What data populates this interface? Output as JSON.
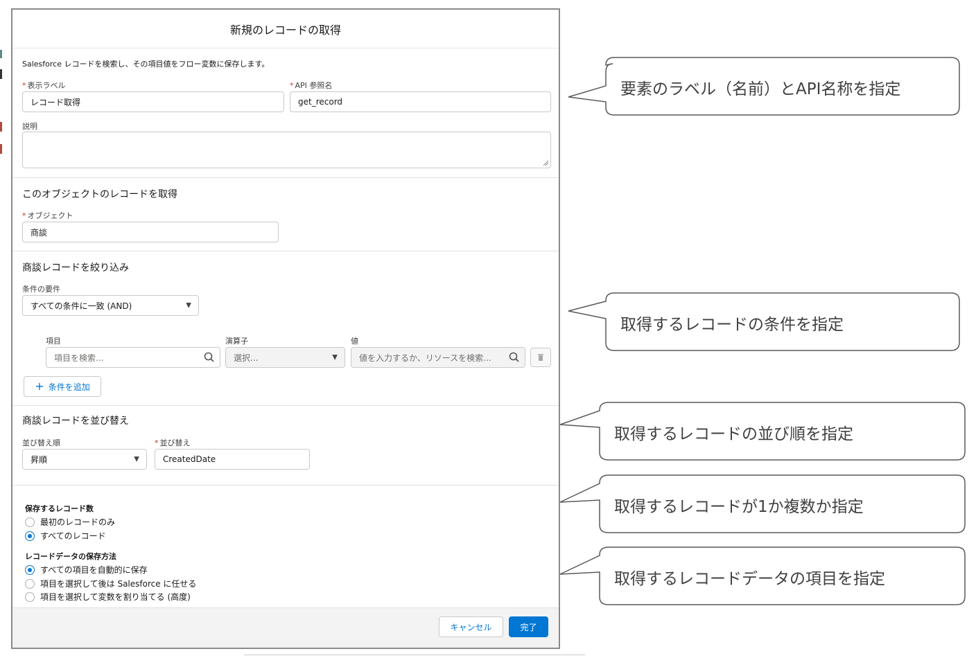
{
  "modal": {
    "title": "新規のレコードの取得",
    "description": "Salesforce レコードを検索し、その項目値をフロー変数に保存します。",
    "required_mark": "*",
    "label_field": {
      "label": "表示ラベル",
      "value": "レコード取得"
    },
    "api_field": {
      "label": "API 参照名",
      "value": "get_record"
    },
    "desc_field": {
      "label": "説明",
      "value": ""
    },
    "object_section": {
      "title": "このオブジェクトのレコードを取得",
      "object_label": "オブジェクト",
      "object_value": "商談"
    },
    "filter_section": {
      "title": "商談レコードを絞り込み",
      "condition_label": "条件の要件",
      "condition_value": "すべての条件に一致 (AND)",
      "col_field": "項目",
      "col_operator": "演算子",
      "col_value": "値",
      "field_placeholder": "項目を検索...",
      "operator_placeholder": "選択...",
      "value_placeholder": "値を入力するか、リソースを検索...",
      "add_condition": "条件を追加"
    },
    "sort_section": {
      "title": "商談レコードを並び替え",
      "order_label": "並び替え順",
      "order_value": "昇順",
      "sortby_label": "並び替え",
      "sortby_value": "CreatedDate"
    },
    "count_section": {
      "label": "保存するレコード数",
      "options": [
        {
          "label": "最初のレコードのみ",
          "selected": false
        },
        {
          "label": "すべてのレコード",
          "selected": true
        }
      ]
    },
    "store_section": {
      "label": "レコードデータの保存方法",
      "options": [
        {
          "label": "すべての項目を自動的に保存",
          "selected": true
        },
        {
          "label": "項目を選択して後は Salesforce に任せる",
          "selected": false
        },
        {
          "label": "項目を選択して変数を割り当てる (高度)",
          "selected": false
        }
      ]
    },
    "footer": {
      "cancel": "キャンセル",
      "done": "完了"
    }
  },
  "callouts": [
    "要素のラベル（名前）とAPI名称を指定",
    "取得するレコードの条件を指定",
    "取得するレコードの並び順を指定",
    "取得するレコードが1か複数か指定",
    "取得するレコードデータの項目を指定"
  ],
  "colors": {
    "brand": "#0176d3",
    "required": "#c23934",
    "callout_border": "#595959"
  }
}
